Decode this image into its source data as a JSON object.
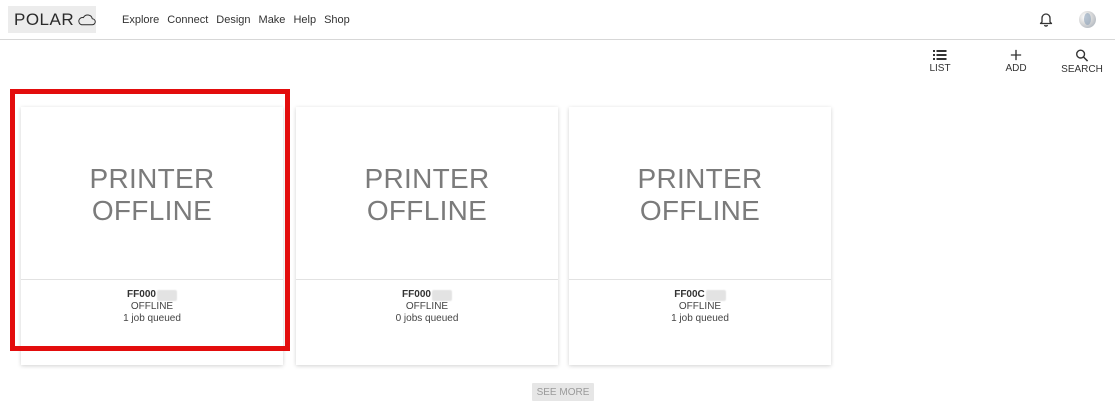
{
  "header": {
    "logo_text": "POLAR",
    "nav": [
      "Explore",
      "Connect",
      "Design",
      "Make",
      "Help",
      "Shop"
    ]
  },
  "toolbar": {
    "list_label": "LIST",
    "add_label": "ADD",
    "search_label": "SEARCH"
  },
  "printers": [
    {
      "status_line1": "PRINTER",
      "status_line2": "OFFLINE",
      "id": "FF000",
      "state": "OFFLINE",
      "queue": "1 job queued"
    },
    {
      "status_line1": "PRINTER",
      "status_line2": "OFFLINE",
      "id": "FF000",
      "state": "OFFLINE",
      "queue": "0 jobs queued"
    },
    {
      "status_line1": "PRINTER",
      "status_line2": "OFFLINE",
      "id": "FF00C",
      "state": "OFFLINE",
      "queue": "1 job queued"
    }
  ],
  "see_more_label": "SEE MORE",
  "icons": {
    "cloud": "cloud-icon",
    "bell": "bell-icon",
    "avatar": "avatar",
    "list": "list-icon",
    "add": "plus-icon",
    "search": "search-icon"
  },
  "colors": {
    "highlight": "#e30d0d",
    "status_text": "#7b7b7b",
    "see_more_bg": "#e6e6e6"
  }
}
